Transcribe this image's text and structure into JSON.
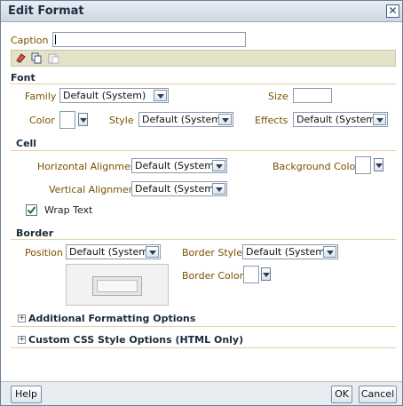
{
  "dialog": {
    "title": "Edit Format"
  },
  "caption": {
    "label": "Caption",
    "value": ""
  },
  "sections": {
    "font": "Font",
    "cell": "Cell",
    "border": "Border"
  },
  "font": {
    "family_label": "Family",
    "family_value": "Default (System)",
    "size_label": "Size",
    "size_value": "",
    "color_label": "Color",
    "style_label": "Style",
    "style_value": "Default (System)",
    "effects_label": "Effects",
    "effects_value": "Default (System)"
  },
  "cell": {
    "h_align_label": "Horizontal Alignment",
    "h_align_value": "Default (System)",
    "bg_color_label": "Background Color",
    "v_align_label": "Vertical Alignment",
    "v_align_value": "Default (System)",
    "wrap_label": "Wrap Text",
    "wrap_checked": true
  },
  "border": {
    "position_label": "Position",
    "position_value": "Default (System)",
    "style_label": "Border Style",
    "style_value": "Default (System)",
    "color_label": "Border Color"
  },
  "expanders": {
    "additional": "Additional Formatting Options",
    "css": "Custom CSS Style Options (HTML Only)"
  },
  "buttons": {
    "help": "Help",
    "ok": "OK",
    "cancel": "Cancel"
  },
  "icons": [
    "eraser-icon",
    "copy-icon",
    "paste-icon"
  ],
  "colors": {
    "label": "#7a5000",
    "title_bar": "#cdd7e2",
    "toolbar": "#e4e3c9"
  }
}
